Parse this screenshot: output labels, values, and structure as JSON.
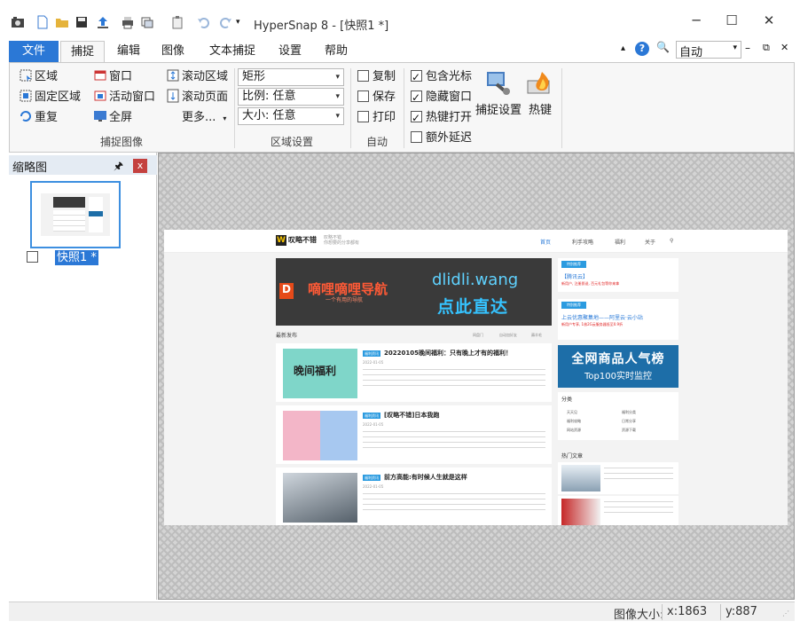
{
  "window": {
    "title": "HyperSnap 8 - [快照1 *]",
    "controls": {
      "minimize": "─",
      "maximize": "☐",
      "close": "✕"
    }
  },
  "quick_access": [
    "camera-icon",
    "new-icon",
    "open-folder-icon",
    "save-icon",
    "upload-icon",
    "print-icon",
    "copy-icon",
    "clipboard-icon",
    "undo-icon",
    "redo-icon",
    "dropdown-icon"
  ],
  "tabs": [
    {
      "label": "文件"
    },
    {
      "label": "捕捉"
    },
    {
      "label": "编辑"
    },
    {
      "label": "图像"
    },
    {
      "label": "文本捕捉"
    },
    {
      "label": "设置"
    },
    {
      "label": "帮助"
    }
  ],
  "tabs_right": {
    "zoom_value": "自动",
    "zoom_arrow": "▾",
    "caret": "▴",
    "help": "?",
    "search": "🔍",
    "minus": "–",
    "restore": "⧉",
    "close": "✕"
  },
  "ribbon": {
    "capture_image": {
      "col1": [
        "区域",
        "固定区域",
        "重复"
      ],
      "col2": [
        "窗口",
        "活动窗口",
        "全屏"
      ],
      "col3": [
        "滚动区域",
        "滚动页面",
        "更多..."
      ],
      "label": "捕捉图像"
    },
    "region_settings": {
      "shape": "矩形",
      "ratio": "比例: 任意",
      "size": "大小: 任意",
      "label": "区域设置"
    },
    "auto": {
      "items": [
        "复制",
        "保存",
        "打印"
      ],
      "label": "自动"
    },
    "options": {
      "items": [
        {
          "label": "包含光标",
          "checked": true
        },
        {
          "label": "隐藏窗口",
          "checked": true
        },
        {
          "label": "热键打开",
          "checked": true
        },
        {
          "label": "额外延迟",
          "checked": false
        }
      ]
    },
    "big_buttons": {
      "capture_settings": "捕捉设置",
      "hotkeys": "热键"
    }
  },
  "thumbnail_pane": {
    "title": "缩略图",
    "pin": "🖈",
    "close": "x",
    "item_label": "快照1 *"
  },
  "screenshot": {
    "site_name": "叹略不错",
    "slogan": "叹略不错\n你想要的分享都有",
    "nav": [
      "首页",
      "利手攻略",
      "福利",
      "关于",
      "⚲"
    ],
    "banner": {
      "title": "嘀哩嘀哩导航",
      "subtitle": "一个有用的导航",
      "url": "dlidli.wang",
      "cta": "点此直达"
    },
    "latest_label": "最新发布",
    "latest_tabs": [
      "网盘门",
      "自动加好友",
      "薅羊毛"
    ],
    "posts": [
      {
        "badge": "福利资讯",
        "title": "20220105晚间福利：只有晚上才有的福利！",
        "date": "2022-01-05"
      },
      {
        "badge": "福利资讯",
        "title": "[叹略不错]日本我跑",
        "date": "2022-01-05"
      },
      {
        "badge": "福利资讯",
        "title": "前方高能:有时候人生就是这样",
        "date": "2022-01-05"
      }
    ],
    "side": [
      {
        "tag": "特别推荐",
        "text": "【腾讯云】",
        "sub": "新用户, 注册即送, 百元礼包等你来拿"
      },
      {
        "tag": "特别推荐",
        "text": "上云优惠聚集地——阿里云·云小站",
        "sub": "新用户专享, 1核2G云服务器低至0.9折"
      }
    ],
    "ad": {
      "line1": "全网商品人气榜",
      "line2": "Top100实时监控"
    },
    "categories": {
      "title": "分类",
      "items": [
        "天天见",
        "福利分类",
        "福利攻略",
        "日常分享",
        "网站资源",
        "资源下载"
      ]
    },
    "hot_title": "热门文章"
  },
  "status": {
    "image_size_label": "图像大小:",
    "x": "x:1863",
    "y": "y:887"
  }
}
